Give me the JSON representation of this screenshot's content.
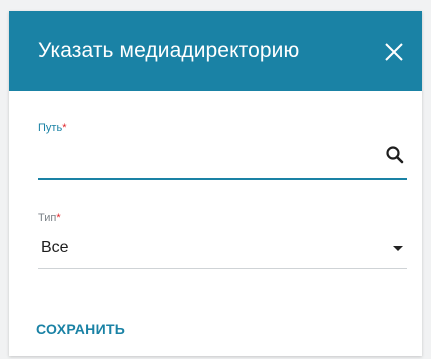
{
  "dialog": {
    "title": "Указать медиадиректорию",
    "close_icon": "close-icon"
  },
  "path_field": {
    "label": "Путь",
    "required_mark": "*",
    "value": "",
    "placeholder": "",
    "search_icon": "search-icon"
  },
  "type_field": {
    "label": "Тип",
    "required_mark": "*",
    "selected": "Все",
    "caret_icon": "caret-down-icon"
  },
  "actions": {
    "save_label": "СОХРАНИТЬ"
  },
  "colors": {
    "accent": "#1a82a5",
    "required": "#e0262b",
    "background": "#f1f2f3"
  }
}
